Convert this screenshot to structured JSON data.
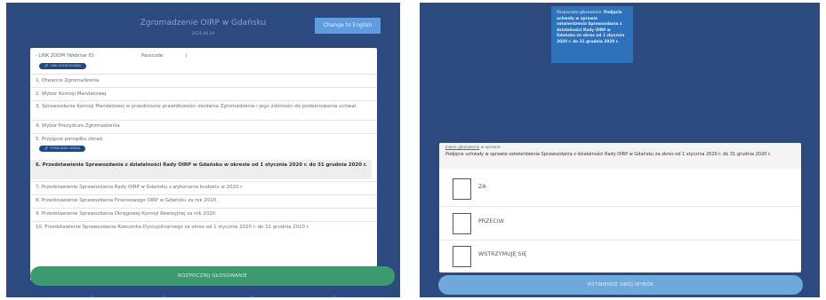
{
  "left": {
    "header": {
      "title": "Zgromadzenie OIRP w Gdańsku",
      "date": "2021.06.26",
      "lang_button": "Change to English"
    },
    "zoom": {
      "link_label": "- LINK ZOOM (Webinar ID:",
      "passcode_label": "Passcode:",
      "passcode_value": ")",
      "pill_label": "LINK ZOOM KLIKNIJ"
    },
    "agenda": [
      {
        "text": "1. Otwarcie Zgromadzenia"
      },
      {
        "text": "2. Wybór Komisji Mandatowej"
      },
      {
        "text": "3. Sprawozdanie Komisji Mandatowej w przedmiocie prawidłowości zwołania Zgromadzenia i jego zdolności do podejmowania uchwał."
      },
      {
        "text": "4. Wybór Prezydium Zgromadzenia"
      },
      {
        "text": "5. Przyjęcie porządku obrad."
      },
      {
        "text": "6. Przedstawienie Sprawozdania z działalności Rady OIRP w Gdańsku w okresie od 1 stycznia 2020 r. do 31 grudnia 2020 r."
      },
      {
        "text": "7. Przedstawienie Sprawozdania Rady OIRP w Gdańsku z wykonania budżetu w 2020 r."
      },
      {
        "text": "8. Przedstawienie Sprawozdania Finansowego OIRP w Gdańsku za rok 2020."
      },
      {
        "text": "9. Przedstawienie Sprawozdania Okręgowej Komisji Rewizyjnej za rok 2020"
      },
      {
        "text": "10. Przedstawienie Sprawozdania Rzecznika Dyscyplinarnego za okres od 1 stycznia 2020 r. do 31 grudnia 2020 r."
      }
    ],
    "porzadek_pill": "PORZĄDEK OBRAD",
    "start_button": "ROZPOCZNIJ GŁOSOWANIE"
  },
  "right": {
    "toast": {
      "prefix": "Rozpoczęto głosowanie:",
      "bold": "Podjęcie uchwały w sprawie zatwierdzenia Sprawozdania z działalności Rady OIRP w Gdańsku za okres od 1 stycznia 2020 r. do 31 grudnia 2020 r."
    },
    "vote": {
      "sub_link": "Jawne głosowanie",
      "sub_rest": " w sprawie:",
      "description": "Podjęcie uchwały w sprawie zatwierdzenia Sprawozdania z działalności Rady OIRP w Gdańsku za okres od 1 stycznia 2020 r. do 31 grudnia 2020 r.",
      "options": [
        "ZA",
        "PRZECIW",
        "WSTRZYMUJĘ SIĘ"
      ]
    },
    "confirm_button": "POTWIERDŹ SWÓJ WYBÓR"
  },
  "colors": {
    "background": "#2d4a80",
    "green": "#3d9a6e",
    "blue_button": "#5f9ce0",
    "confirm": "#6fa8db",
    "pill": "#1f4780",
    "toast": "#2d72bb"
  }
}
